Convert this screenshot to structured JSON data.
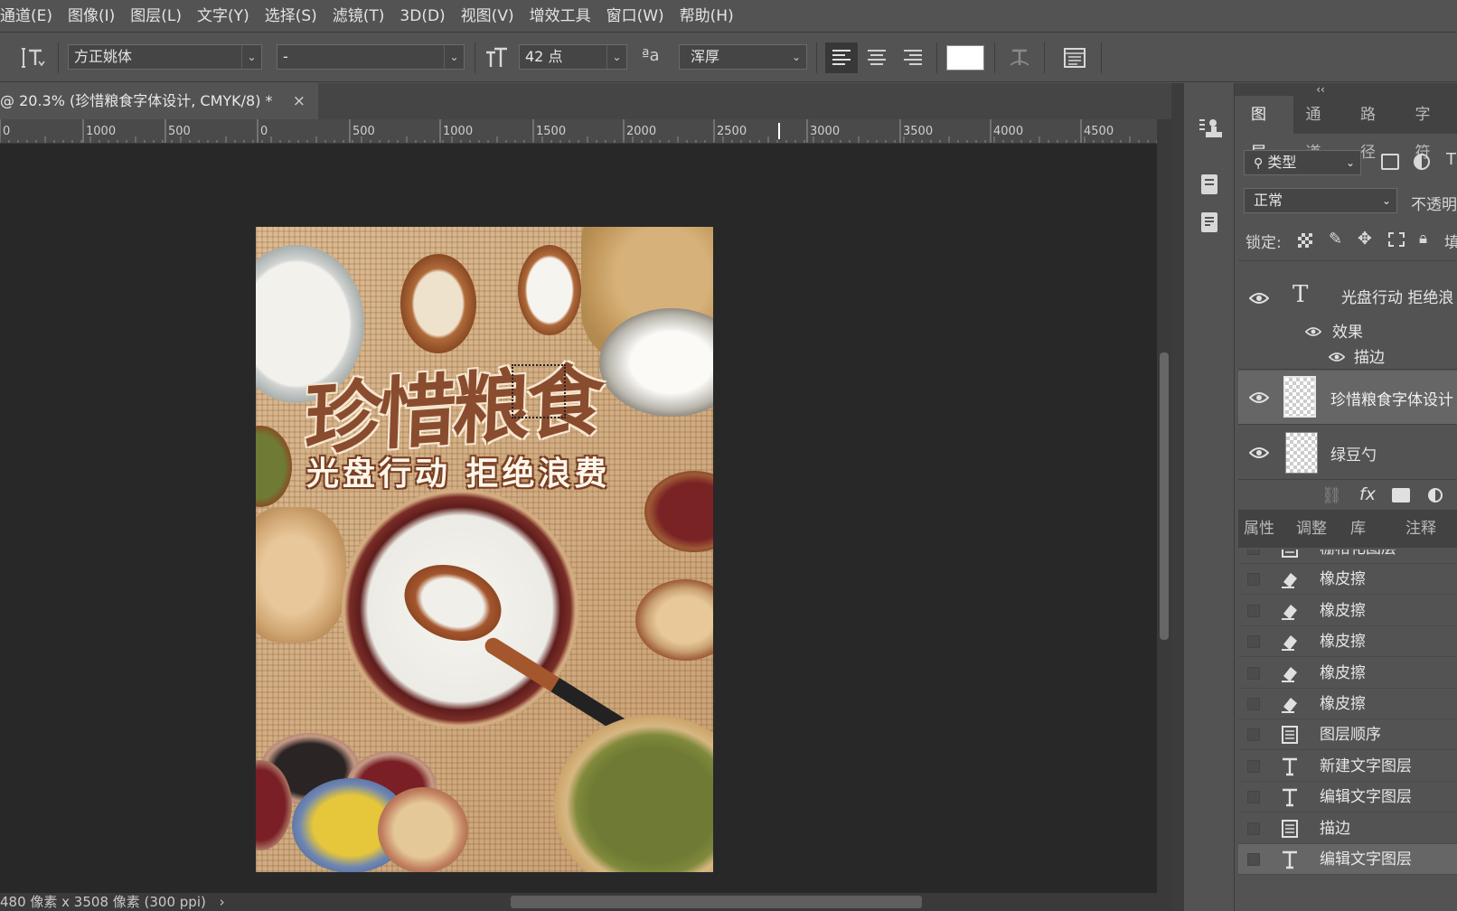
{
  "menu": [
    "通道(E)",
    "图像(I)",
    "图层(L)",
    "文字(Y)",
    "选择(S)",
    "滤镜(T)",
    "3D(D)",
    "视图(V)",
    "增效工具",
    "窗口(W)",
    "帮助(H)"
  ],
  "options": {
    "font_family": "方正姚体",
    "font_style": "-",
    "font_size": "42 点",
    "anti_alias": "浑厚",
    "text_color": "#ffffff"
  },
  "document_tab": {
    "title": "@ 20.3% (珍惜粮食字体设计, CMYK/8) *",
    "close": "×"
  },
  "ruler": {
    "labels": [
      "0",
      "1000",
      "500",
      "0",
      "500",
      "1000",
      "1500",
      "2000",
      "2500",
      "3000",
      "3500",
      "4000",
      "4500"
    ]
  },
  "status": "480 像素 x 3508 像素 (300 ppi)",
  "status_arrow": "›",
  "artwork": {
    "headline": "珍惜粮食",
    "subline": "光盘行动 拒绝浪费"
  },
  "layers_panel": {
    "tabs": [
      "图层",
      "通道",
      "路径",
      "字符"
    ],
    "filter_label": "类型",
    "blend_mode": "正常",
    "opacity_label": "不透明",
    "lock_label": "锁定:",
    "fill_label": "填",
    "layers": [
      {
        "name": "光盘行动 拒绝浪",
        "kind": "text"
      },
      {
        "name": "效果",
        "kind": "effect"
      },
      {
        "name": "描边",
        "kind": "effect-item"
      },
      {
        "name": "珍惜粮食字体设计",
        "kind": "image"
      },
      {
        "name": "绿豆勺",
        "kind": "image"
      }
    ]
  },
  "bottom_panel": {
    "tabs": [
      "属性",
      "调整",
      "库",
      "注释"
    ],
    "history": [
      {
        "label": "栅格化图层",
        "icon": "doc"
      },
      {
        "label": "橡皮擦",
        "icon": "eraser"
      },
      {
        "label": "橡皮擦",
        "icon": "eraser"
      },
      {
        "label": "橡皮擦",
        "icon": "eraser"
      },
      {
        "label": "橡皮擦",
        "icon": "eraser"
      },
      {
        "label": "橡皮擦",
        "icon": "eraser"
      },
      {
        "label": "图层顺序",
        "icon": "doc"
      },
      {
        "label": "新建文字图层",
        "icon": "text"
      },
      {
        "label": "编辑文字图层",
        "icon": "text"
      },
      {
        "label": "描边",
        "icon": "doc"
      },
      {
        "label": "编辑文字图层",
        "icon": "text"
      }
    ]
  }
}
